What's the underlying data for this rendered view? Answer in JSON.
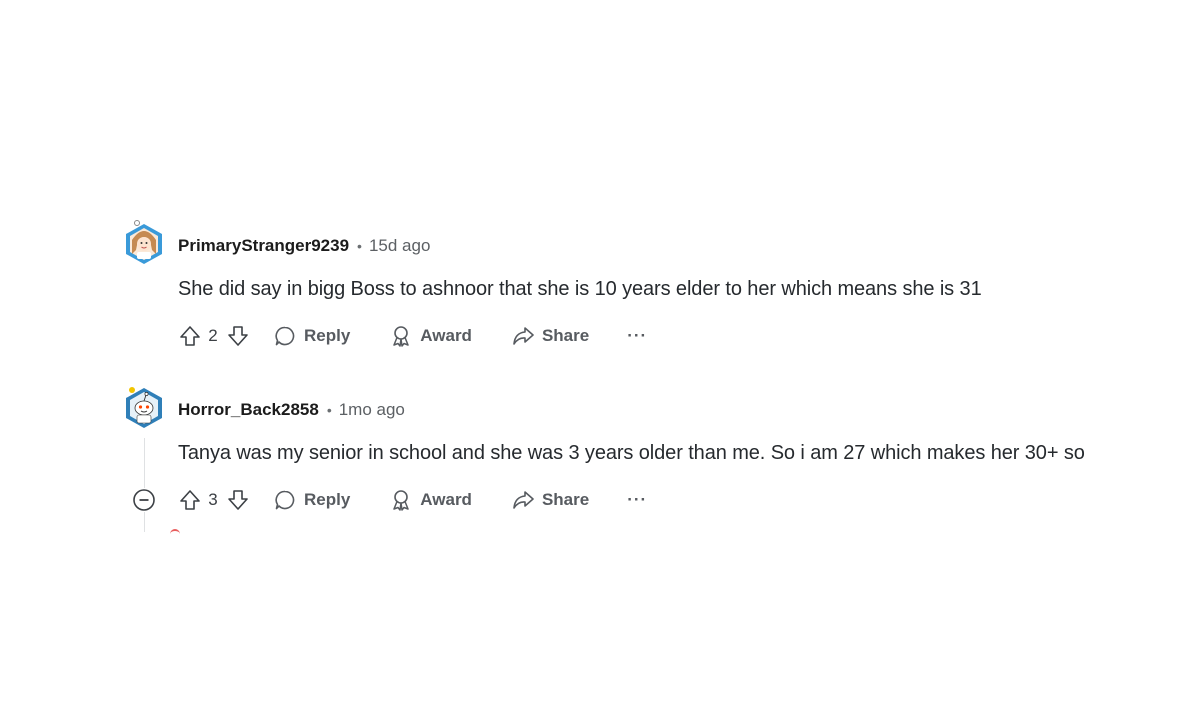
{
  "comments": [
    {
      "username": "PrimaryStranger9239",
      "separator": "•",
      "time": "15d ago",
      "body": "She did say in bigg Boss to ashnoor that she is 10 years elder to her which means she is 31",
      "score": "2",
      "actions": {
        "reply": "Reply",
        "award": "Award",
        "share": "Share",
        "more": "···"
      }
    },
    {
      "username": "Horror_Back2858",
      "separator": "•",
      "time": "1mo ago",
      "body": "Tanya was my senior in school and she was 3 years older than me. So i am 27 which makes her 30+ so",
      "score": "3",
      "actions": {
        "reply": "Reply",
        "award": "Award",
        "share": "Share",
        "more": "···"
      }
    }
  ],
  "icons": {
    "upvote": "upvote-arrow-icon",
    "downvote": "downvote-arrow-icon",
    "reply": "speech-bubble-icon",
    "award": "ribbon-award-icon",
    "share": "share-arrow-icon",
    "collapse": "minus-circle-icon"
  },
  "colors": {
    "text": "#1c1c1c",
    "muted": "#5c6064",
    "action": "#575b60",
    "thread_line": "#dfe1e3"
  }
}
